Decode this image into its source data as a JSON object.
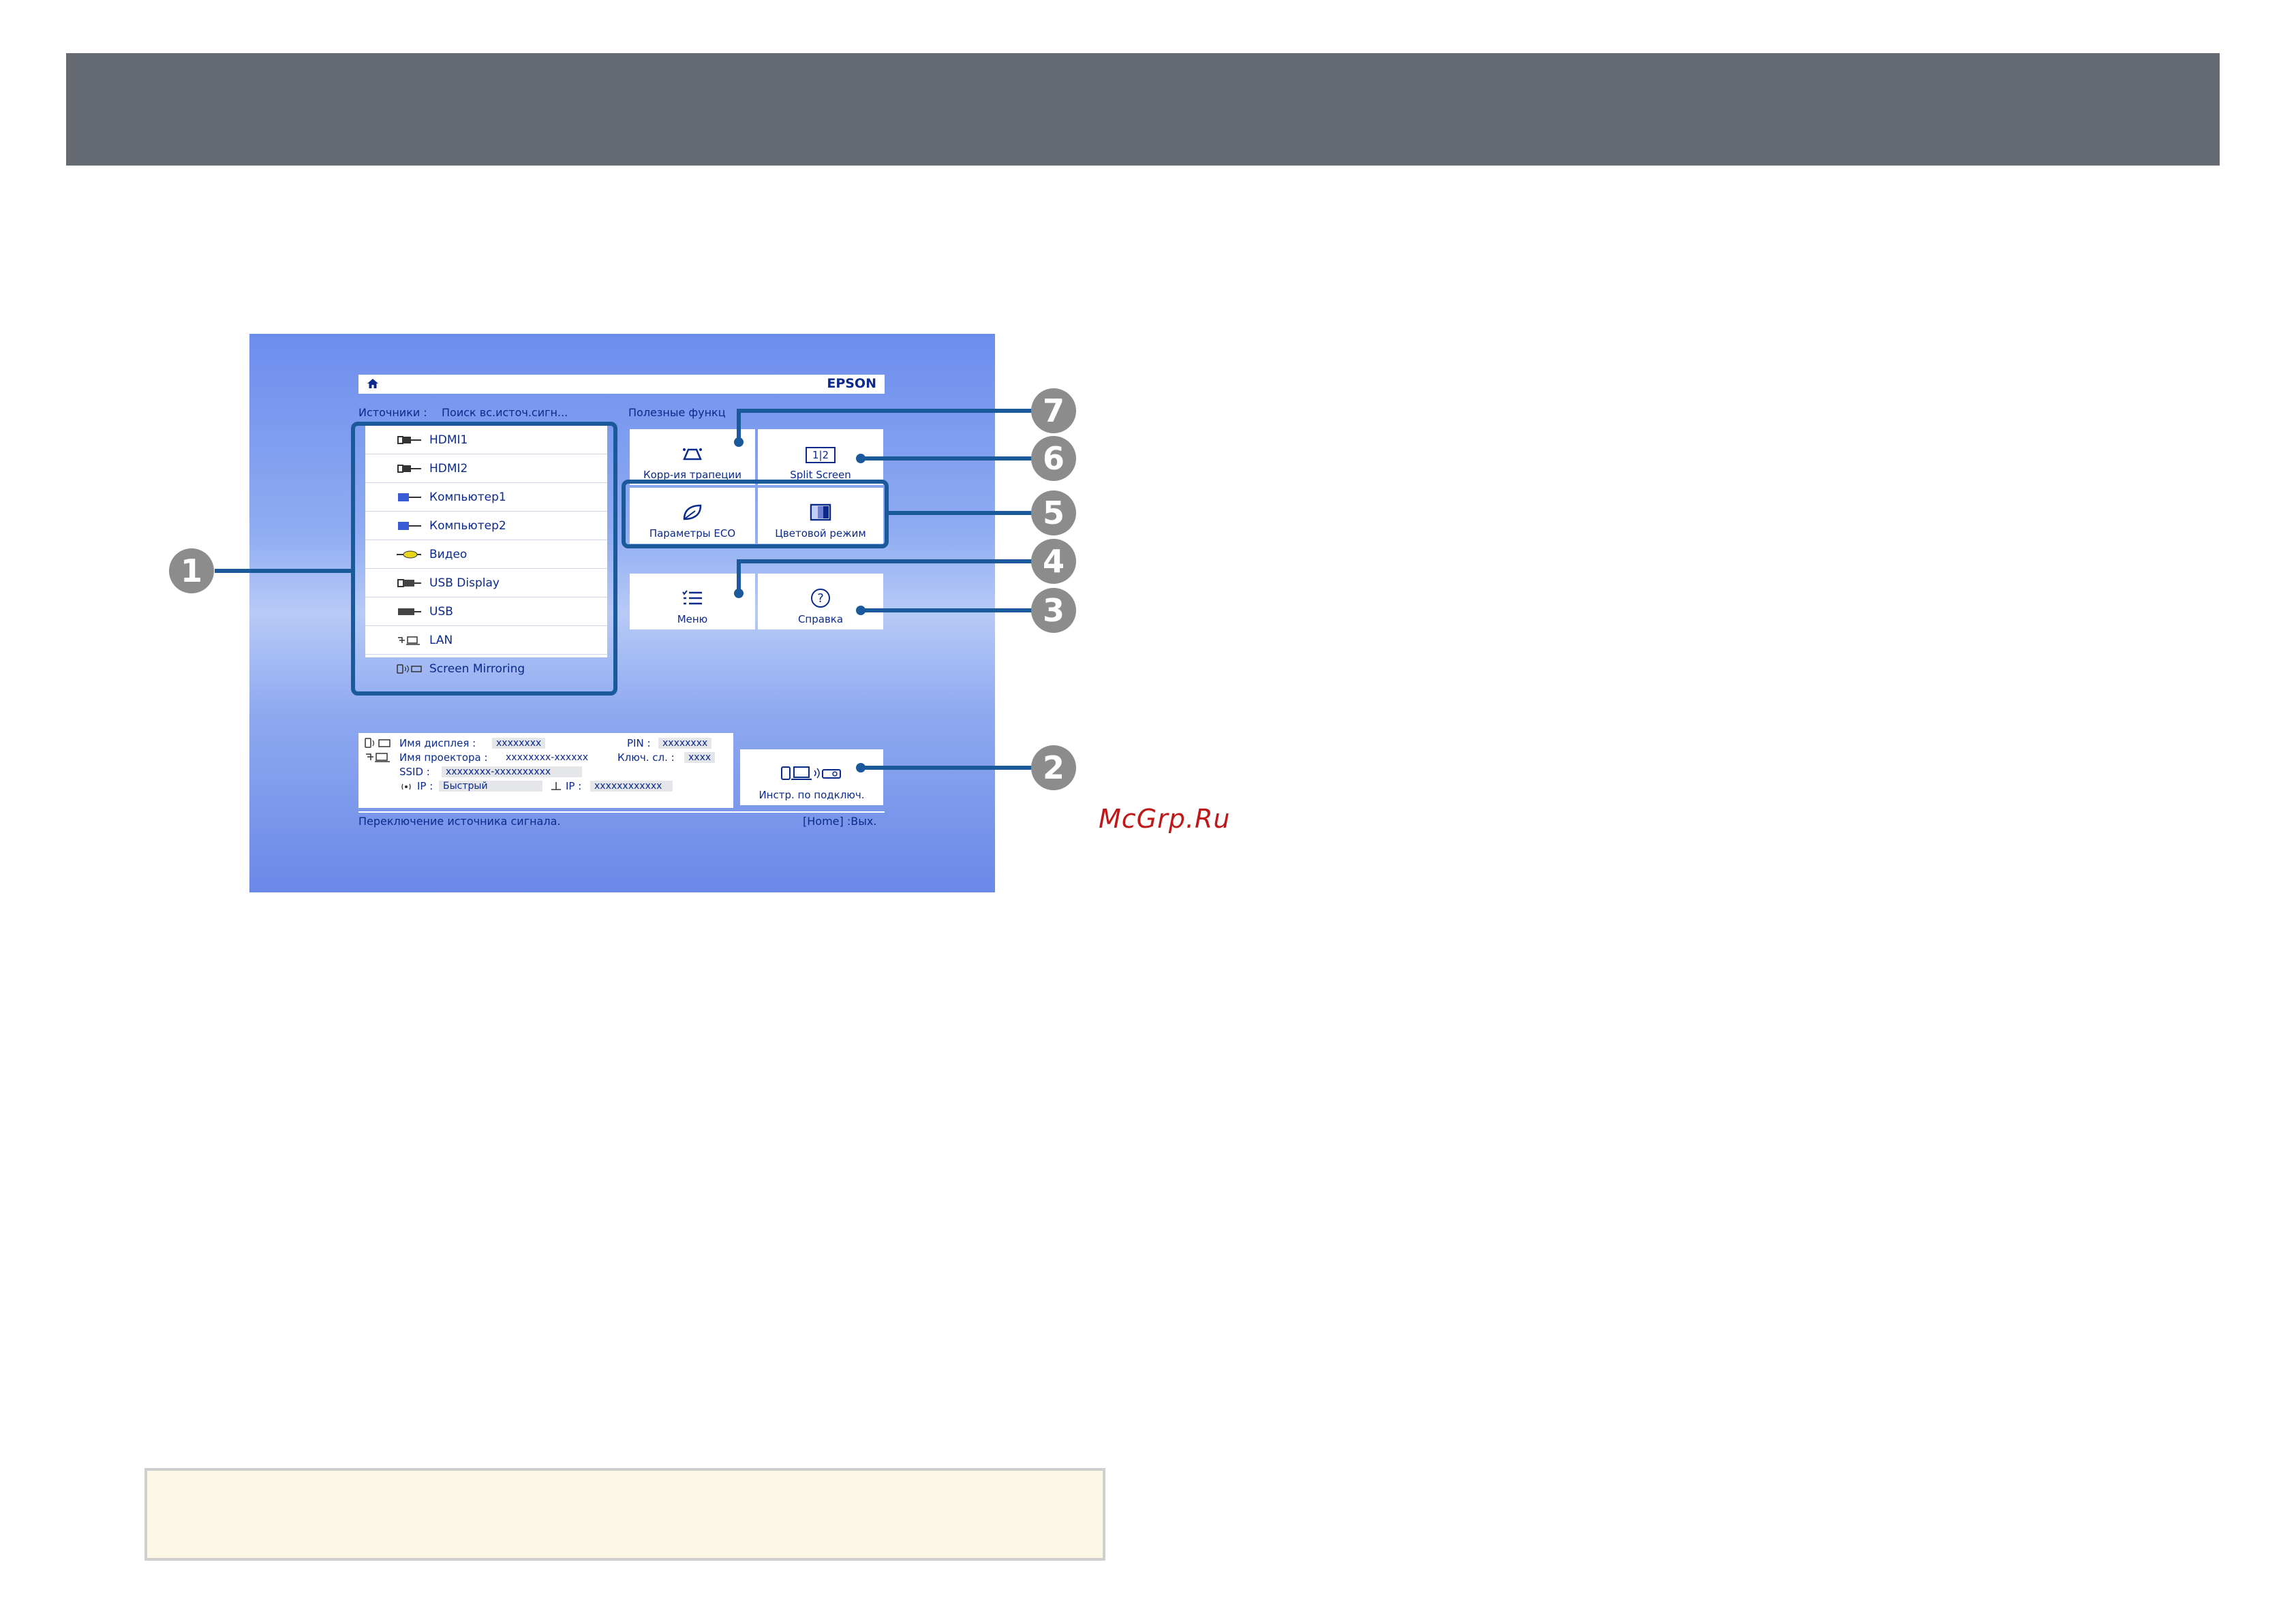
{
  "screen": {
    "brand": "EPSON",
    "sources_heading": "Источники :",
    "search_label": "Поиск вс.источ.сигн...",
    "functions_heading": "Полезные функц",
    "sources": [
      {
        "label": "HDMI1",
        "icon": "hdmi-icon"
      },
      {
        "label": "HDMI2",
        "icon": "hdmi-icon"
      },
      {
        "label": "Компьютер1",
        "icon": "vga-icon"
      },
      {
        "label": "Компьютер2",
        "icon": "vga-icon"
      },
      {
        "label": "Видео",
        "icon": "video-icon"
      },
      {
        "label": "USB Display",
        "icon": "usb-display-icon"
      },
      {
        "label": "USB",
        "icon": "usb-icon"
      },
      {
        "label": "LAN",
        "icon": "lan-icon"
      },
      {
        "label": "Screen Mirroring",
        "icon": "screen-mirroring-icon"
      }
    ],
    "tiles": {
      "keystone": "Корр-ия трапеции",
      "split": "Split Screen",
      "split_glyph": "1|2",
      "eco": "Параметры ECO",
      "color": "Цветовой режим",
      "menu": "Меню",
      "help": "Справка",
      "help_glyph": "?",
      "connect": "Инстр. по подключ."
    },
    "info": {
      "display_name_label": "Имя дисплея :",
      "display_name_value": "xxxxxxxx",
      "pin_label": "PIN :",
      "pin_value": "xxxxxxxx",
      "projector_name_label": "Имя проектора :",
      "projector_name_value": "xxxxxxxx-xxxxxx",
      "key_label": "Ключ. сл. :",
      "key_value": "xxxx",
      "ssid_label": "SSID :",
      "ssid_value": "xxxxxxxx-xxxxxxxxxx",
      "ip_label": "IP :",
      "ip_value": "Быстрый",
      "ip2_label": "IP :",
      "ip2_value": "xxxxxxxxxxxx"
    },
    "footer_left": "Переключение источника сигнала.",
    "footer_right": "[Home] :Вых."
  },
  "callouts": [
    "1",
    "2",
    "3",
    "4",
    "5",
    "6",
    "7"
  ],
  "watermark": "McGrp.Ru",
  "colors": {
    "header": "#666a73",
    "callout": "#1a5a9a",
    "screen_text": "#0b2a8c",
    "badge": "#8c8c8c",
    "note_bg": "#fdf7e6"
  }
}
